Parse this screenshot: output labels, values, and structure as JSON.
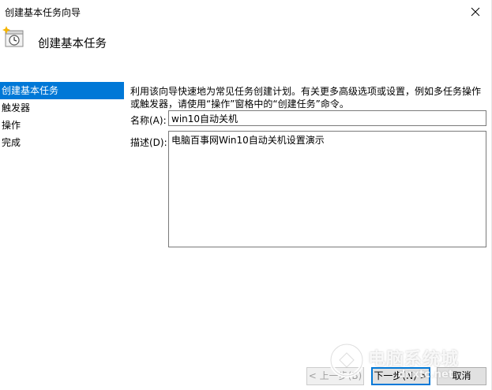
{
  "window": {
    "title": "创建基本任务向导"
  },
  "header": {
    "title": "创建基本任务",
    "icon": "scheduled-task-clock-icon"
  },
  "sidebar": {
    "items": [
      {
        "label": "创建基本任务",
        "active": true
      },
      {
        "label": "触发器",
        "active": false
      },
      {
        "label": "操作",
        "active": false
      },
      {
        "label": "完成",
        "active": false
      }
    ]
  },
  "content": {
    "description_text": "利用该向导快速地为常见任务创建计划。有关更多高级选项或设置，例如多任务操作或触发器，请使用“操作”窗格中的“创建任务”命令。",
    "name_label": "名称(A):",
    "name_value": "win10自动关机",
    "desc_label": "描述(D):",
    "desc_value": "电脑百事网Win10自动关机设置演示"
  },
  "buttons": {
    "back": "< 上一步(B)",
    "next": "下一步(N) >",
    "cancel": "取消"
  },
  "watermark": {
    "title": "电脑系统城",
    "url": "dnxtc.net"
  },
  "colors": {
    "accent": "#0078d7",
    "border": "#7a7a7a"
  }
}
